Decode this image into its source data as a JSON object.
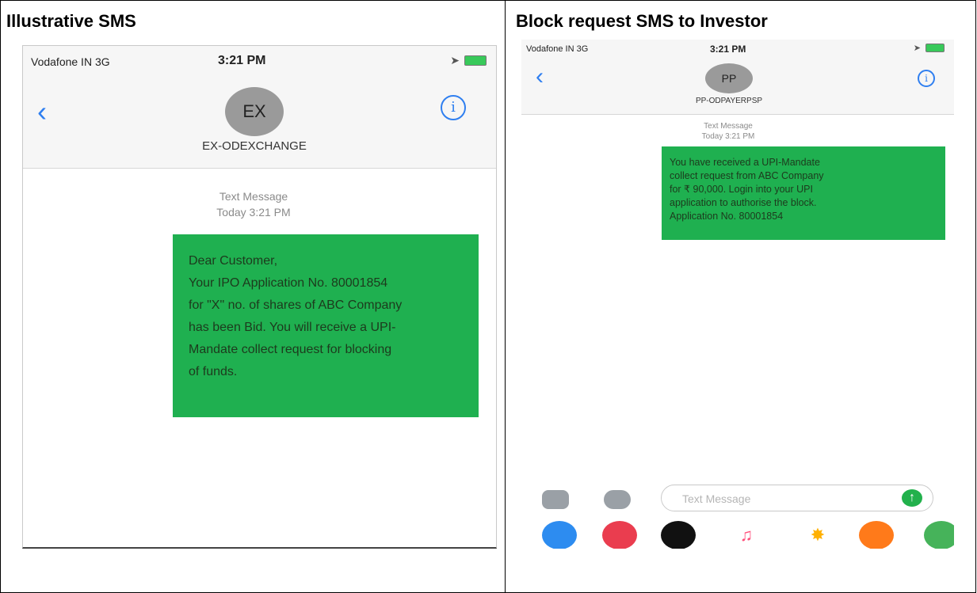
{
  "left": {
    "title": "Illustrative SMS",
    "status": {
      "carrier": "Vodafone IN  3G",
      "time": "3:21 PM"
    },
    "avatar_initials": "EX",
    "sender_name": "EX-ODEXCHANGE",
    "stamp_line1": "Text Message",
    "stamp_line2": "Today 3:21 PM",
    "message_lines": [
      "Dear Customer,",
      "Your IPO Application No. 80001854",
      "for \"X\" no. of shares of ABC Company",
      "has been Bid. You will receive a UPI-",
      "Mandate collect request for blocking",
      "of funds."
    ]
  },
  "right": {
    "title": "Block request SMS to Investor",
    "status": {
      "carrier": "Vodafone IN  3G",
      "time": "3:21 PM"
    },
    "avatar_initials": "PP",
    "sender_name": "PP-ODPAYERPSP",
    "stamp_line1": "Text Message",
    "stamp_line2": "Today 3:21 PM",
    "message_lines": [
      "You have received a UPI-Mandate",
      "collect request from ABC Company",
      "for ₹ 90,000. Login into your UPI",
      "application to authorise the block.",
      "Application No. 80001854"
    ],
    "input_placeholder": "Text Message"
  },
  "colors": {
    "bubble": "#1fb050",
    "accent": "#2f7ff0",
    "avatar": "#9a9a9a"
  },
  "icons": [
    "back-chevron-icon",
    "info-icon",
    "camera-icon",
    "app-store-icon",
    "send-arrow-icon"
  ]
}
